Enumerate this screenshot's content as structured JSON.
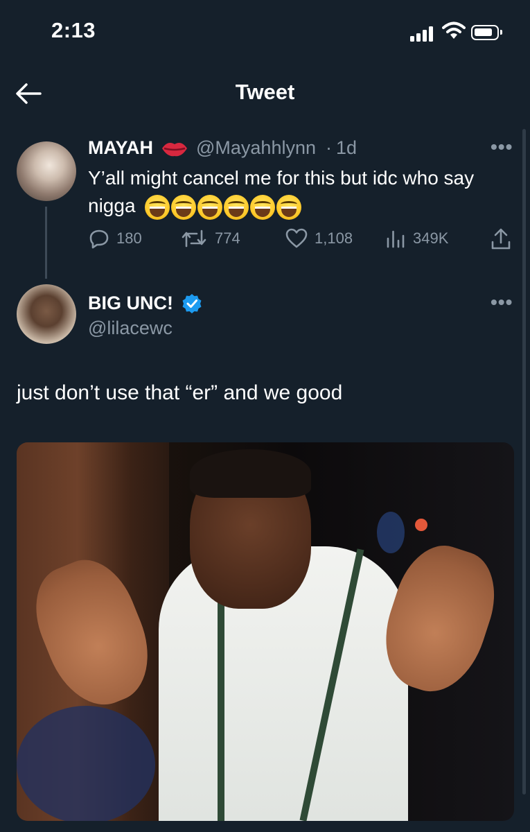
{
  "status_bar": {
    "time": "2:13"
  },
  "header": {
    "title": "Tweet"
  },
  "parent_tweet": {
    "name": "MAYAH",
    "handle": "@Mayahhlynn",
    "separator": "·",
    "age": "1d",
    "more": "•••",
    "text": "Y’all might cancel me for this but idc who say nigga",
    "emoji": [
      "😂",
      "😂",
      "😂",
      "😂",
      "😂",
      "😂"
    ],
    "stats": {
      "replies": "180",
      "retweets": "774",
      "likes": "1,108",
      "views": "349K"
    }
  },
  "reply_tweet": {
    "name": "BIG UNC!",
    "handle": "@lilacewc",
    "more": "•••",
    "text": "just don’t use that “er” and we good",
    "verified": true
  },
  "colors": {
    "background": "#15202b",
    "secondary_text": "#8b98a5",
    "verified_blue": "#1d9bf0"
  },
  "icons": [
    "back-arrow-icon",
    "signal-icon",
    "wifi-icon",
    "battery-icon",
    "lips-icon",
    "verified-badge-icon",
    "reply-icon",
    "retweet-icon",
    "like-icon",
    "views-icon",
    "share-icon"
  ]
}
